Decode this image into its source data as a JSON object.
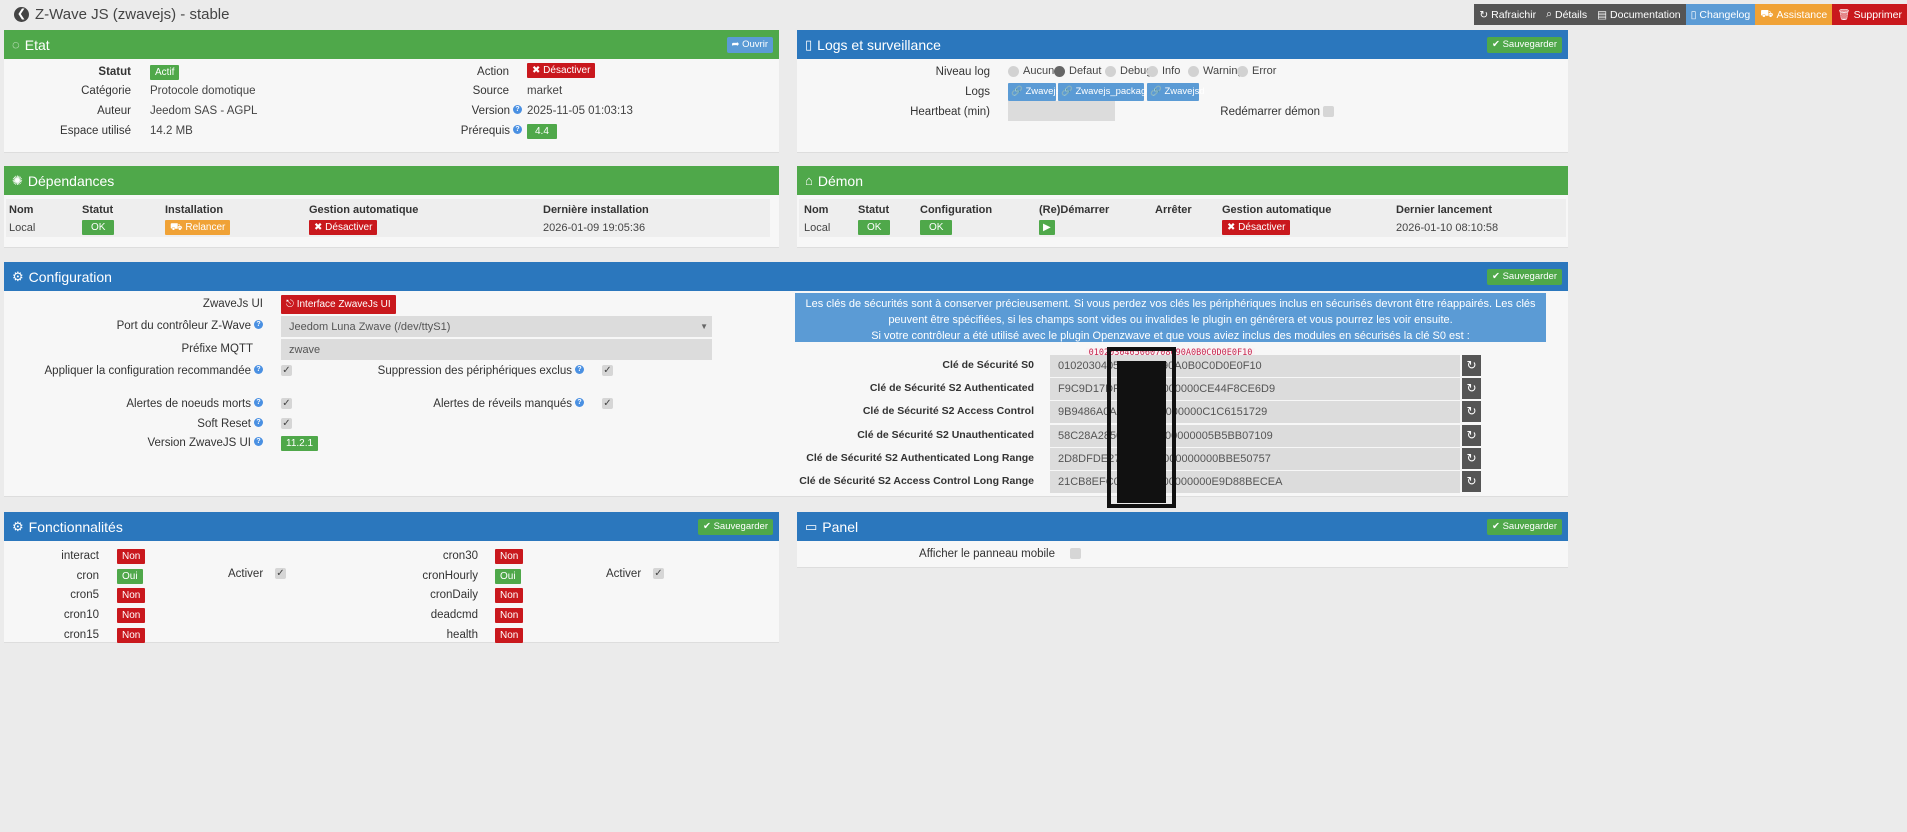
{
  "page": {
    "title": "Z-Wave JS (zwavejs) - stable"
  },
  "toolbar": [
    {
      "label": "Rafraichir",
      "icon": "refresh-icon",
      "glyph": "↻",
      "color": "#555555"
    },
    {
      "label": "Détails",
      "icon": "search-icon",
      "glyph": "⌕",
      "color": "#555555"
    },
    {
      "label": "Documentation",
      "icon": "book-icon",
      "glyph": "▤",
      "color": "#555555"
    },
    {
      "label": "Changelog",
      "icon": "file-icon",
      "glyph": "▯",
      "color": "#5b9bd5"
    },
    {
      "label": "Assistance",
      "icon": "truck-icon",
      "glyph": "⛟",
      "color": "#f0a236"
    },
    {
      "label": "Supprimer",
      "icon": "trash-icon",
      "glyph": "🗑",
      "color": "#c9181d"
    }
  ],
  "etat": {
    "title": "Etat",
    "open_label": "Ouvrir",
    "statut_label": "Statut",
    "statut_value": "Actif",
    "categorie_label": "Catégorie",
    "categorie_value": "Protocole domotique",
    "auteur_label": "Auteur",
    "auteur_value": "Jeedom SAS - AGPL",
    "espace_label": "Espace utilisé",
    "espace_value": "14.2 MB",
    "action_label": "Action",
    "action_value": "Désactiver",
    "source_label": "Source",
    "source_value": "market",
    "version_label": "Version",
    "version_value": "2025-11-05 01:03:13",
    "prerequis_label": "Prérequis",
    "prerequis_value": "4.4"
  },
  "logs": {
    "title": "Logs et surveillance",
    "save_label": "Sauvegarder",
    "niveau_label": "Niveau log",
    "levels": [
      "Aucun",
      "Defaut",
      "Debug",
      "Info",
      "Warning",
      "Error"
    ],
    "selected_level": "Defaut",
    "logs_label": "Logs",
    "log_buttons": [
      "Zwavejs",
      "Zwavejs_packages",
      "Zwavejsd"
    ],
    "heartbeat_label": "Heartbeat (min)",
    "redemarrer_label": "Redémarrer démon"
  },
  "dependances": {
    "title": "Dépendances",
    "headers": [
      "Nom",
      "Statut",
      "Installation",
      "Gestion automatique",
      "Dernière installation"
    ],
    "row": {
      "nom": "Local",
      "statut": "OK",
      "installation": "Relancer",
      "gestion": "Désactiver",
      "derniere": "2026-01-09 19:05:36"
    }
  },
  "demon": {
    "title": "Démon",
    "headers": [
      "Nom",
      "Statut",
      "Configuration",
      "(Re)Démarrer",
      "Arrêter",
      "Gestion automatique",
      "Dernier lancement"
    ],
    "row": {
      "nom": "Local",
      "statut": "OK",
      "configuration": "OK",
      "gestion": "Désactiver",
      "dernier": "2026-01-10 08:10:58"
    }
  },
  "configuration": {
    "title": "Configuration",
    "save_label": "Sauvegarder",
    "zwavejs_ui_label": "ZwaveJs UI",
    "zwavejs_ui_button": "Interface ZwaveJs UI",
    "port_label": "Port du contrôleur Z-Wave",
    "port_value": "Jeedom Luna Zwave (/dev/ttyS1)",
    "prefixe_label": "Préfixe MQTT",
    "prefixe_value": "zwave",
    "appliquer_label": "Appliquer la configuration recommandée",
    "suppression_label": "Suppression des périphériques exclus",
    "alertes_morts_label": "Alertes de noeuds morts",
    "alertes_reveils_label": "Alertes de réveils manqués",
    "soft_reset_label": "Soft Reset",
    "version_ui_label": "Version ZwaveJS UI",
    "version_ui_value": "11.2.1",
    "info_line1": "Les clés de sécurités sont à conserver précieusement. Si vous perdez vos clés les périphériques inclus en sécurisés devront être réappairés. Les clés peuvent être spécifiées, si les champs sont vides ou invalides le plugin en générera et vous pourrez les voir ensuite.",
    "info_line2": "Si votre contrôleur a été utilisé avec le plugin Openzwave et que vous aviez inclus des modules en sécurisés la clé S0 est :",
    "info_code": "0102030405060708090A0B0C0D0E0F10",
    "keys": [
      {
        "label": "Clé de Sécurité S0",
        "value": "0102030405060708090A0B0C0D0E0F10"
      },
      {
        "label": "Clé de Sécurité S2 Authenticated",
        "value": "F9C9D17DF0000000000000CE44F8CE6D9"
      },
      {
        "label": "Clé de Sécurité S2 Access Control",
        "value": "9B9486A0A00000000000000C1C6151729"
      },
      {
        "label": "Clé de Sécurité S2 Unauthenticated",
        "value": "58C28A2850000000000000005B5BB07109"
      },
      {
        "label": "Clé de Sécurité S2 Authenticated Long Range",
        "value": "2D8DFDE270000000000000000BBE50757"
      },
      {
        "label": "Clé de Sécurité S2 Access Control Long Range",
        "value": "21CB8EFC0000000000000000E9D88BECEA"
      }
    ]
  },
  "fonctionnalites": {
    "title": "Fonctionnalités",
    "save_label": "Sauvegarder",
    "left": [
      {
        "name": "interact",
        "value": "Non"
      },
      {
        "name": "cron",
        "value": "Oui"
      },
      {
        "name": "cron5",
        "value": "Non"
      },
      {
        "name": "cron10",
        "value": "Non"
      },
      {
        "name": "cron15",
        "value": "Non"
      }
    ],
    "right": [
      {
        "name": "cron30",
        "value": "Non"
      },
      {
        "name": "cronHourly",
        "value": "Oui"
      },
      {
        "name": "cronDaily",
        "value": "Non"
      },
      {
        "name": "deadcmd",
        "value": "Non"
      },
      {
        "name": "health",
        "value": "Non"
      }
    ],
    "activer_label": "Activer"
  },
  "panel": {
    "title": "Panel",
    "save_label": "Sauvegarder",
    "mobile_label": "Afficher le panneau mobile"
  }
}
